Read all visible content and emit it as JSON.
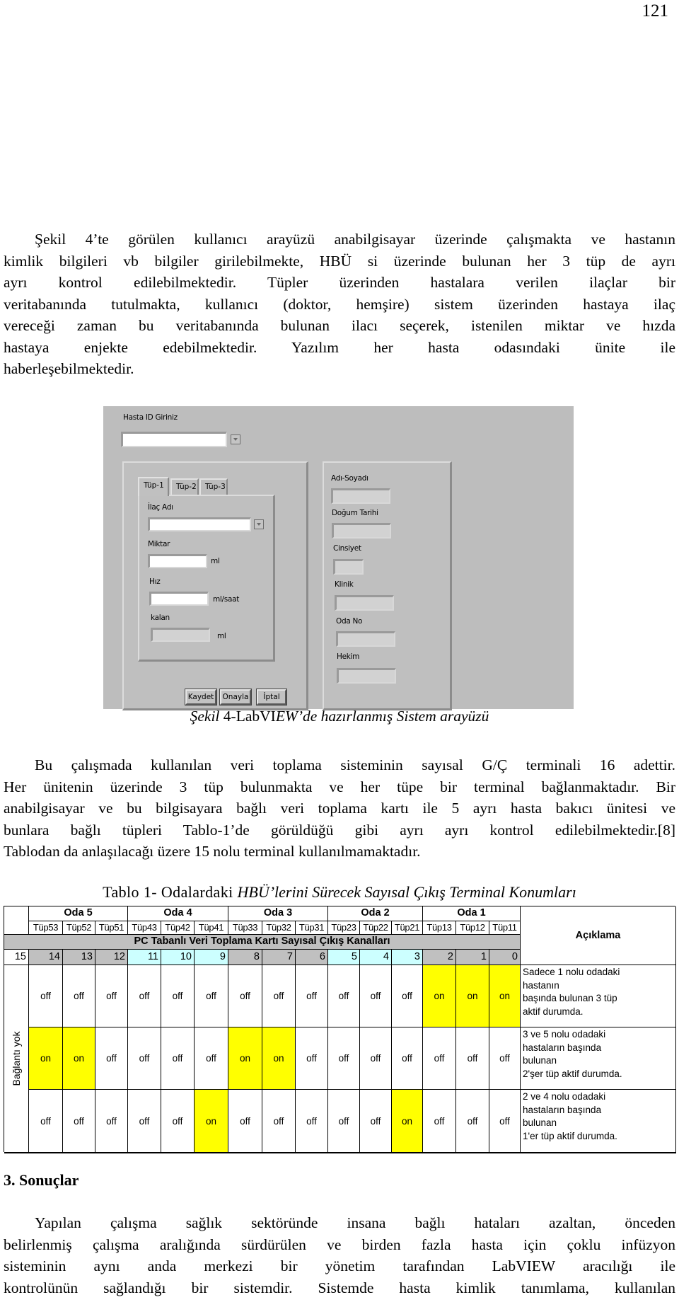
{
  "page_number": "121",
  "paragraph_1": {
    "lines": [
      "Şekil 4’te görülen kullanıcı arayüzü anabilgisayar üzerinde çalışmakta ve hastanın",
      "kimlik bilgileri vb bilgiler girilebilmekte, HBÜ si üzerinde bulunan her 3 tüp de ayrı",
      "ayrı kontrol edilebilmektedir. Tüpler üzerinden hastalara verilen ilaçlar bir",
      "veritabanında tutulmakta, kullanıcı (doktor, hemşire) sistem üzerinden hastaya ilaç",
      "vereceği zaman bu veritabanında bulunan ilacı seçerek, istenilen miktar ve hızda",
      "hastaya enjekte edebilmektedir. Yazılım her hasta odasındaki ünite ile",
      "haberleşebilmektedir."
    ]
  },
  "figure": {
    "patient_id_label": "Hasta ID Giriniz",
    "patient_id_value": "",
    "tabs": [
      {
        "label": "Tüp-1",
        "active": true
      },
      {
        "label": "Tüp-2",
        "active": false
      },
      {
        "label": "Tüp-3",
        "active": false
      }
    ],
    "drug_label": "İlaç Adı",
    "drug_value": "",
    "amount_label": "Miktar",
    "amount_value": "",
    "amount_unit": "ml",
    "rate_label": "Hız",
    "rate_value": "",
    "rate_unit": "ml/saat",
    "remaining_label": "kalan",
    "remaining_value": "",
    "remaining_unit": "ml",
    "buttons": {
      "save": "Kaydet",
      "confirm": "Onayla",
      "cancel": "İptal"
    },
    "patient_info": {
      "name_label": "Adı-Soyadı",
      "birth_label": "Doğum Tarihi",
      "gender_label": "Cinsiyet",
      "clinic_label": "Klinik",
      "room_label": "Oda No",
      "doctor_label": "Hekim"
    }
  },
  "caption": {
    "italic_1": "Şekil ",
    "upright": "4-LabVI",
    "italic_2": "EW’de hazırlanmış Sistem arayüzü"
  },
  "paragraph_2": {
    "lines": [
      "Bu çalışmada kullanılan veri toplama sisteminin sayısal G/Ç terminali 16 adettir.",
      "Her ünitenin üzerinde 3 tüp bulunmakta ve her tüpe bir terminal bağlanmaktadır. Bir",
      "anabilgisayar ve bu bilgisayara bağlı veri toplama kartı ile 5 ayrı hasta bakıcı ünitesi ve",
      "bunlara bağlı tüpleri Tablo-1’de görüldüğü gibi ayrı ayrı kontrol edilebilmektedir.[8]",
      "Tablodan da anlaşılacağı üzere 15 nolu terminal kullanılmamaktadır."
    ]
  },
  "table": {
    "title_plain": "Tablo 1- Odalardaki ",
    "title_italic": "HBÜ’lerini Sürecek Sayısal Çıkış Terminal Konumları",
    "rooms": [
      "Oda 5",
      "Oda 4",
      "Oda 3",
      "Oda 2",
      "Oda 1"
    ],
    "tubes": [
      "Tüp53",
      "Tüp52",
      "Tüp51",
      "Tüp43",
      "Tüp42",
      "Tüp41",
      "Tüp33",
      "Tüp32",
      "Tüp31",
      "Tüp23",
      "Tüp22",
      "Tüp21",
      "Tüp13",
      "Tüp12",
      "Tüp11"
    ],
    "band_label": "PC Tabanlı Veri Toplama  Kartı Sayısal Çıkış Kanalları",
    "channels": [
      "15",
      "14",
      "13",
      "12",
      "11",
      "10",
      "9",
      "8",
      "7",
      "6",
      "5",
      "4",
      "3",
      "2",
      "1",
      "0"
    ],
    "description_header": "Açıklama",
    "unconnected_label": "Bağlantı yok",
    "rows": [
      {
        "states": [
          "off",
          "off",
          "off",
          "off",
          "off",
          "off",
          "off",
          "off",
          "off",
          "off",
          "off",
          "off",
          "on",
          "on",
          "on"
        ],
        "description": "Sadece 1 nolu odadaki\nhastanın\nbaşında bulunan 3 tüp\naktif durumda."
      },
      {
        "states": [
          "on",
          "on",
          "off",
          "off",
          "off",
          "off",
          "on",
          "on",
          "off",
          "off",
          "off",
          "off",
          "off",
          "off",
          "off"
        ],
        "description": "3 ve 5 nolu odadaki\nhastaların başında\nbulunan\n2'şer tüp aktif durumda."
      },
      {
        "states": [
          "off",
          "off",
          "off",
          "off",
          "off",
          "on",
          "off",
          "off",
          "off",
          "off",
          "off",
          "on",
          "off",
          "off",
          "off"
        ],
        "description": "2 ve 4 nolu odadaki\nhastaların başında\nbulunan\n1'er tüp aktif durumda."
      }
    ]
  },
  "section_heading": "3. Sonuçlar",
  "paragraph_3": {
    "lines": [
      "Yapılan çalışma sağlık sektöründe insana bağlı hataları azaltan, önceden",
      "belirlenmiş çalışma aralığında sürdürülen ve birden fazla hasta için çoklu infüzyon",
      "sisteminin aynı anda merkezi bir yönetim tarafından LabVIEW aracılığı ile",
      "kontrolünün sağlandığı bir sistemdir. Sistemde hasta kimlik tanımlama, kullanılan"
    ]
  }
}
